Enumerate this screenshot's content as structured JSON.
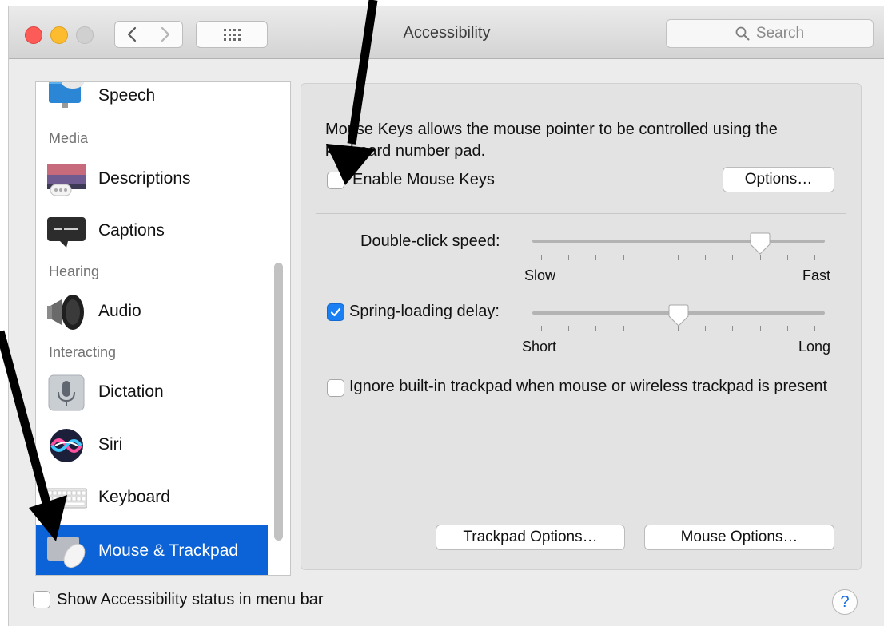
{
  "window": {
    "title": "Accessibility",
    "search_placeholder": "Search"
  },
  "sidebar": {
    "items": [
      {
        "type": "item",
        "label": "Speech",
        "icon": "speech-icon"
      },
      {
        "type": "heading",
        "label": "Media"
      },
      {
        "type": "item",
        "label": "Descriptions",
        "icon": "descriptions-icon"
      },
      {
        "type": "item",
        "label": "Captions",
        "icon": "captions-icon"
      },
      {
        "type": "heading",
        "label": "Hearing"
      },
      {
        "type": "item",
        "label": "Audio",
        "icon": "speaker-icon"
      },
      {
        "type": "heading",
        "label": "Interacting"
      },
      {
        "type": "item",
        "label": "Dictation",
        "icon": "microphone-icon"
      },
      {
        "type": "item",
        "label": "Siri",
        "icon": "siri-icon"
      },
      {
        "type": "item",
        "label": "Keyboard",
        "icon": "keyboard-icon"
      },
      {
        "type": "item",
        "label": "Mouse & Trackpad",
        "icon": "mouse-trackpad-icon",
        "selected": true
      }
    ]
  },
  "panel": {
    "description": "Mouse Keys allows the mouse pointer to be controlled using the keyboard number pad.",
    "enable_mouse_keys": {
      "label": "Enable Mouse Keys",
      "checked": false
    },
    "options_button": "Options…",
    "double_click": {
      "label": "Double-click speed:",
      "min_label": "Slow",
      "max_label": "Fast",
      "value": 0.78
    },
    "spring_loading": {
      "label": "Spring-loading delay:",
      "checked": true,
      "min_label": "Short",
      "max_label": "Long",
      "value": 0.5
    },
    "ignore_trackpad": {
      "label": "Ignore built-in trackpad when mouse or wireless trackpad is present",
      "checked": false
    },
    "trackpad_options_button": "Trackpad Options…",
    "mouse_options_button": "Mouse Options…"
  },
  "footer": {
    "show_status": {
      "label": "Show Accessibility status in menu bar",
      "checked": false
    },
    "help_label": "?"
  },
  "colors": {
    "selection": "#0b63d7",
    "checkbox_checked": "#1b7ff4",
    "annotation_arrow": "#000000"
  }
}
